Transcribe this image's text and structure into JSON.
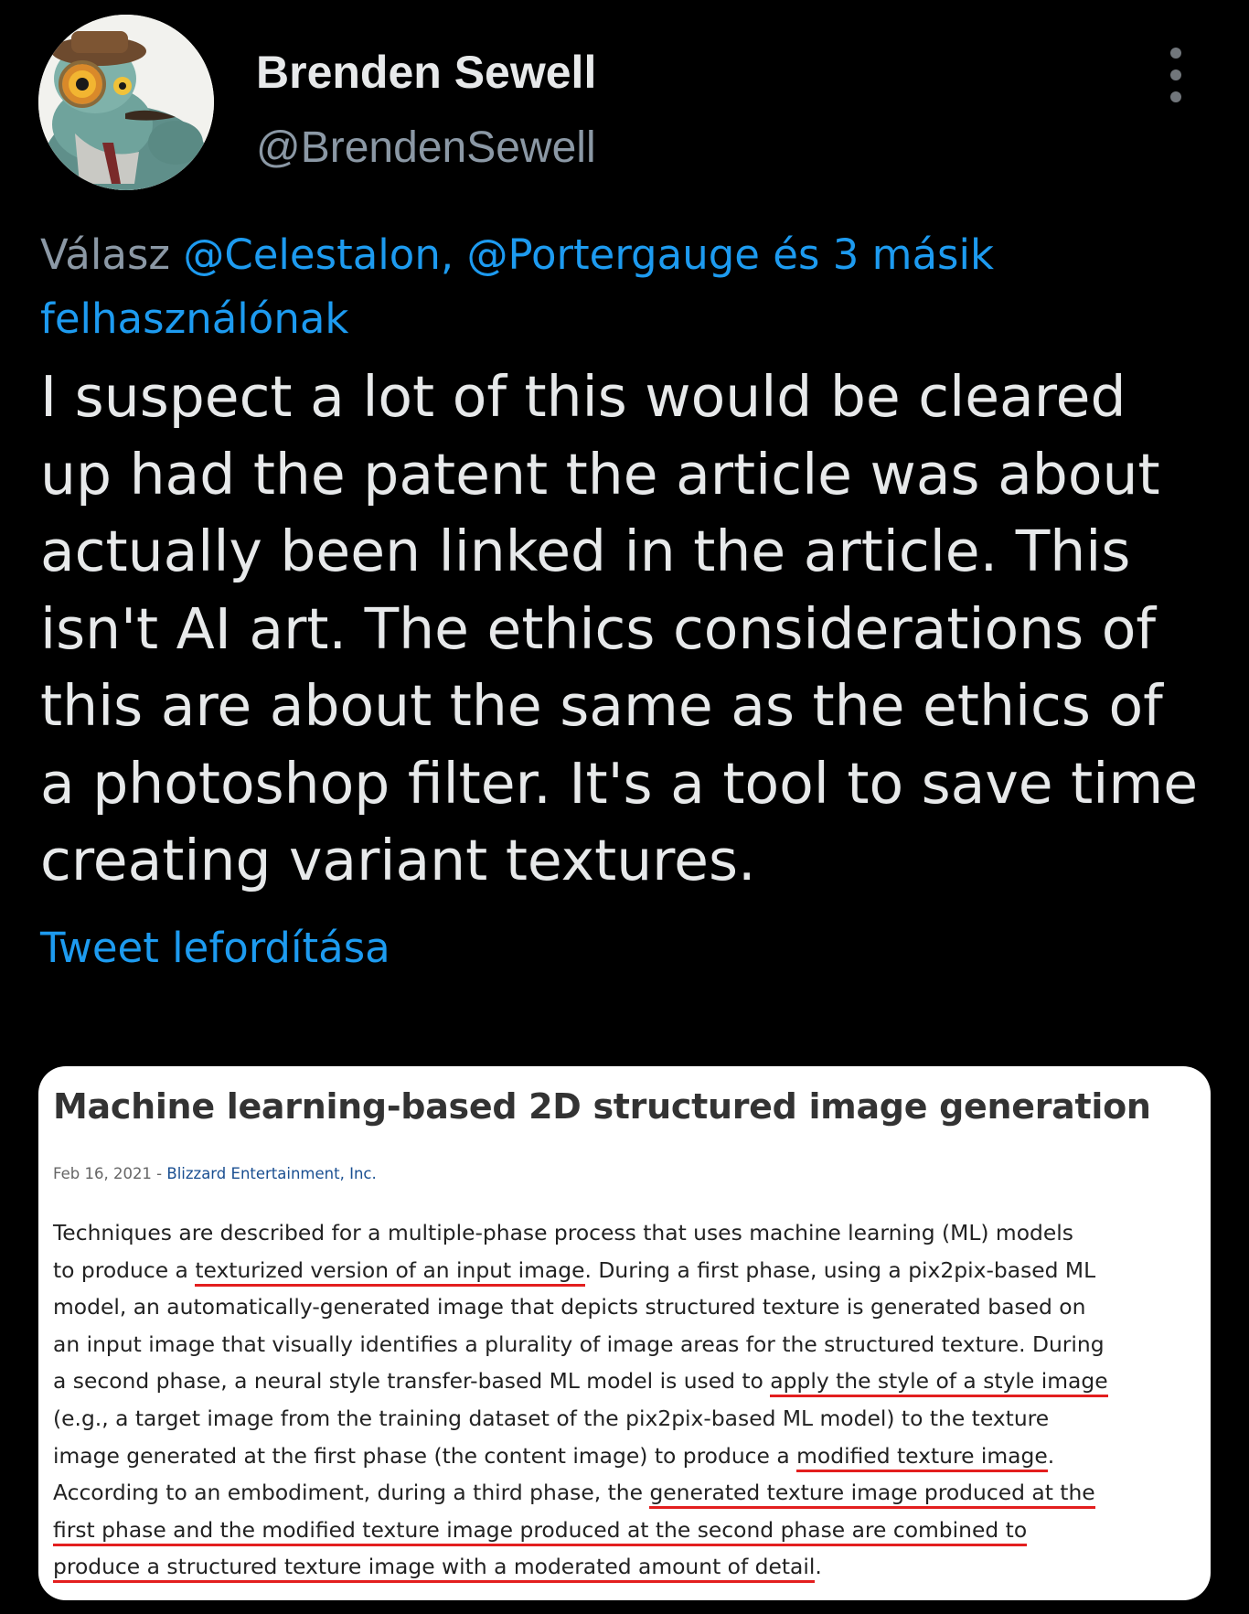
{
  "author": {
    "display_name": "Brenden Sewell",
    "handle": "@BrendenSewell",
    "avatar_icon": "frog-detective-avatar"
  },
  "reply": {
    "prefix": "Válasz",
    "mentions": "@Celestalon, @Portergauge és 3 másik felhasználónak"
  },
  "tweet": {
    "lines": [
      "I suspect a lot of this would be cleared",
      "up had the patent the article was about",
      "actually been linked in the article. This",
      "isn't AI art. The ethics considerations of",
      "this are about the same as the ethics of",
      "a photoshop filter. It's a tool to save time",
      "creating variant textures."
    ],
    "translate_label": "Tweet lefordítása"
  },
  "card": {
    "title": "Machine learning-based 2D structured image generation",
    "date": "Feb 16, 2021",
    "separator": " - ",
    "company": "Blizzard Entertainment, Inc.",
    "abstract": {
      "l1": "Techniques are described for a multiple-phase process that uses machine learning (ML) models",
      "l2a": "to produce a ",
      "l2u": "texturized version of an input image",
      "l2b": ". During a first phase, using a pix2pix-based ML",
      "l3": "model, an automatically-generated image that depicts structured texture is generated based on",
      "l4": "an input image that visually identifies a plurality of image areas for the structured texture. During",
      "l5a": "a second phase, a neural style transfer-based ML model is used to ",
      "l5u": "apply the style of a style image",
      "l6": "(e.g., a target image from the training dataset of the pix2pix-based ML model) to the texture",
      "l7a": "image generated at the first phase (the content image) to produce a ",
      "l7u": "modified texture image",
      "l7b": ".",
      "l8a": "According to an embodiment, during a third phase, the ",
      "l8u": "generated texture image produced at the",
      "l9u": "first phase and the modified texture image produced at the second phase are combined to",
      "l10u": "produce a structured texture image with a moderated amount of detail",
      "l10b": "."
    },
    "underline_color": "#e31e1e"
  },
  "colors": {
    "background": "#000000",
    "text": "#e7e9ea",
    "secondary": "#8b98a5",
    "link": "#1d9bf0"
  }
}
